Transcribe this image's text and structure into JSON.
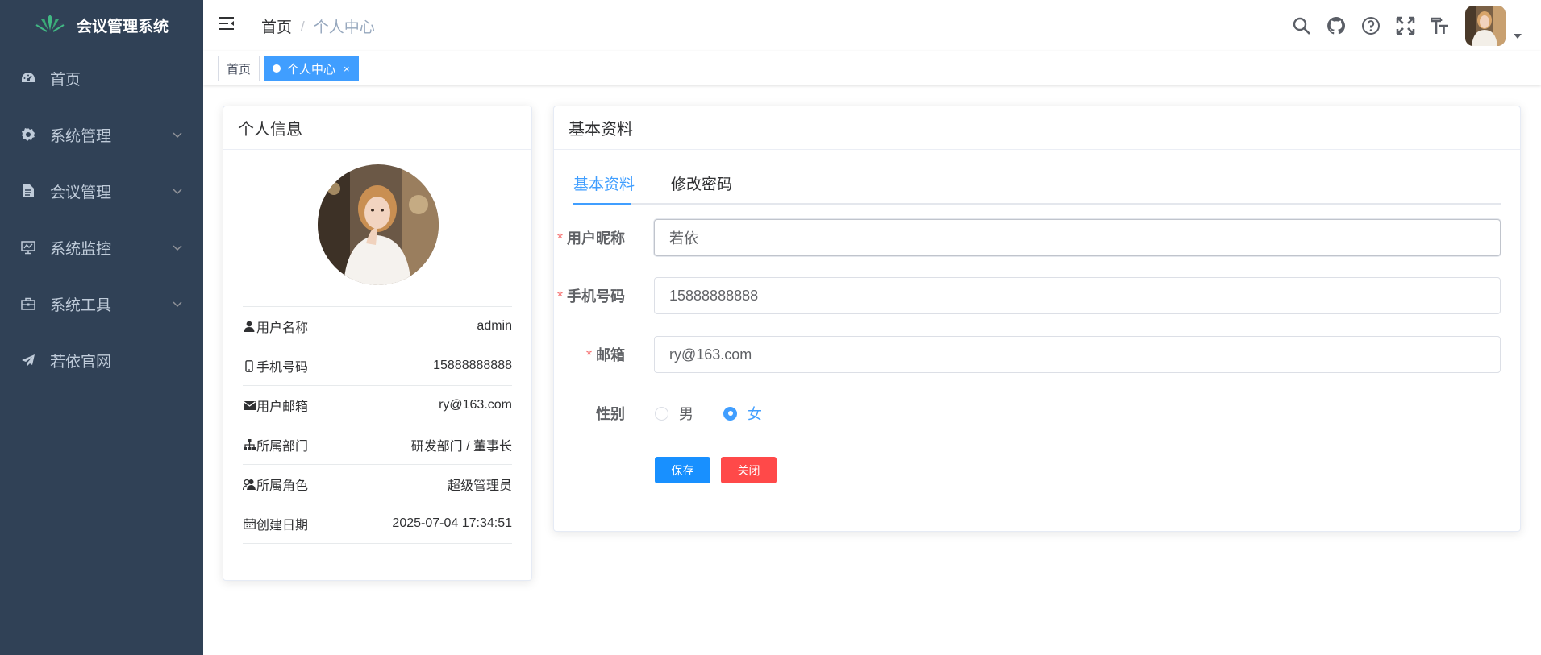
{
  "app": {
    "title": "会议管理系统"
  },
  "sidebar": {
    "items": [
      {
        "label": "首页",
        "icon": "dashboard-icon",
        "expandable": false
      },
      {
        "label": "系统管理",
        "icon": "gear-icon",
        "expandable": true
      },
      {
        "label": "会议管理",
        "icon": "document-icon",
        "expandable": true
      },
      {
        "label": "系统监控",
        "icon": "monitor-icon",
        "expandable": true
      },
      {
        "label": "系统工具",
        "icon": "toolbox-icon",
        "expandable": true
      },
      {
        "label": "若依官网",
        "icon": "paper-plane-icon",
        "expandable": false
      }
    ]
  },
  "header": {
    "breadcrumb": {
      "home": "首页",
      "separator": "/",
      "current": "个人中心"
    },
    "icons": [
      "search-icon",
      "github-icon",
      "help-icon",
      "fullscreen-icon",
      "font-size-icon"
    ]
  },
  "tags": [
    {
      "label": "首页",
      "active": false
    },
    {
      "label": "个人中心",
      "active": true,
      "close": "×"
    }
  ],
  "profile": {
    "title": "个人信息",
    "rows": [
      {
        "label": "用户名称",
        "value": "admin",
        "icon": "user-icon"
      },
      {
        "label": "手机号码",
        "value": "15888888888",
        "icon": "phone-icon"
      },
      {
        "label": "用户邮箱",
        "value": "ry@163.com",
        "icon": "mail-icon"
      },
      {
        "label": "所属部门",
        "value": "研发部门 / 董事长",
        "icon": "tree-icon"
      },
      {
        "label": "所属角色",
        "value": "超级管理员",
        "icon": "peoples-icon"
      },
      {
        "label": "创建日期",
        "value": "2025-07-04 17:34:51",
        "icon": "calendar-icon"
      }
    ]
  },
  "basic": {
    "title": "基本资料",
    "tabs": [
      {
        "label": "基本资料",
        "active": true
      },
      {
        "label": "修改密码",
        "active": false
      }
    ],
    "form": {
      "nickname": {
        "label": "用户昵称",
        "required": true,
        "value": "若依"
      },
      "phone": {
        "label": "手机号码",
        "required": true,
        "value": "15888888888"
      },
      "email": {
        "label": "邮箱",
        "required": true,
        "value": "ry@163.com"
      },
      "gender": {
        "label": "性别",
        "options": [
          "男",
          "女"
        ],
        "selected": "女"
      }
    },
    "buttons": {
      "save": "保存",
      "close": "关闭"
    }
  },
  "colors": {
    "sidebar_bg": "#304156",
    "primary": "#1890ff",
    "danger": "#ff4949",
    "active_tab": "#409eff"
  }
}
